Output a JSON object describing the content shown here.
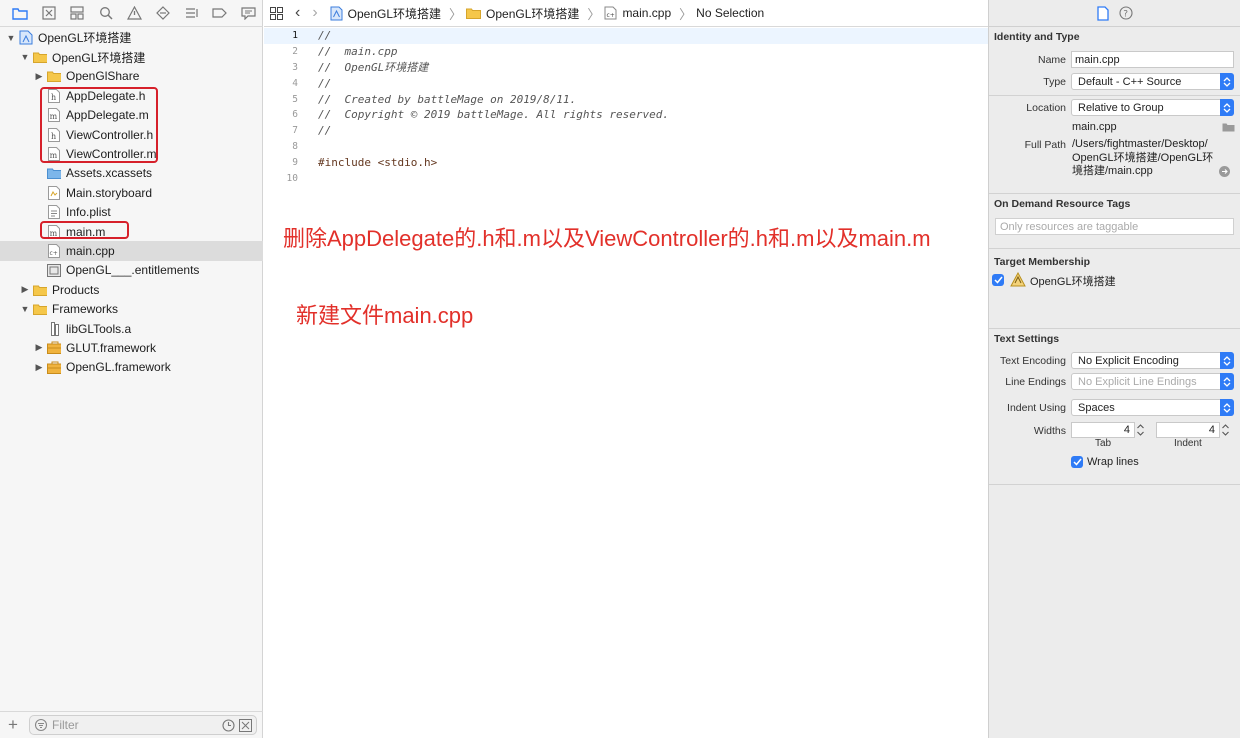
{
  "navigator": {
    "tree": [
      {
        "label": "OpenGL环境搭建",
        "icon": "project-icon",
        "level": 0,
        "disclosure": "open"
      },
      {
        "label": "OpenGL环境搭建",
        "icon": "folder-icon",
        "level": 1,
        "disclosure": "open"
      },
      {
        "label": "OpenGlShare",
        "icon": "folder-icon",
        "level": 2,
        "disclosure": "closed"
      },
      {
        "label": "AppDelegate.h",
        "icon": "header-file-icon",
        "level": 2,
        "disclosure": "none"
      },
      {
        "label": "AppDelegate.m",
        "icon": "objc-file-icon",
        "level": 2,
        "disclosure": "none"
      },
      {
        "label": "ViewController.h",
        "icon": "header-file-icon",
        "level": 2,
        "disclosure": "none"
      },
      {
        "label": "ViewController.m",
        "icon": "objc-file-icon",
        "level": 2,
        "disclosure": "none"
      },
      {
        "label": "Assets.xcassets",
        "icon": "asset-catalog-icon",
        "level": 2,
        "disclosure": "none"
      },
      {
        "label": "Main.storyboard",
        "icon": "storyboard-icon",
        "level": 2,
        "disclosure": "none"
      },
      {
        "label": "Info.plist",
        "icon": "plist-icon",
        "level": 2,
        "disclosure": "none"
      },
      {
        "label": "main.m",
        "icon": "objc-file-icon",
        "level": 2,
        "disclosure": "none"
      },
      {
        "label": "main.cpp",
        "icon": "cpp-file-icon",
        "level": 2,
        "disclosure": "none",
        "selected": true
      },
      {
        "label": "OpenGL___.entitlements",
        "icon": "entitlements-icon",
        "level": 2,
        "disclosure": "none"
      },
      {
        "label": "Products",
        "icon": "folder-icon",
        "level": 1,
        "disclosure": "closed"
      },
      {
        "label": "Frameworks",
        "icon": "folder-icon",
        "level": 1,
        "disclosure": "open"
      },
      {
        "label": "libGLTools.a",
        "icon": "library-icon",
        "level": 2,
        "disclosure": "none"
      },
      {
        "label": "GLUT.framework",
        "icon": "framework-icon",
        "level": 2,
        "disclosure": "closed"
      },
      {
        "label": "OpenGL.framework",
        "icon": "framework-icon",
        "level": 2,
        "disclosure": "closed"
      }
    ],
    "filter_placeholder": "Filter"
  },
  "jumpbar": {
    "crumbs": [
      "OpenGL环境搭建",
      "OpenGL环境搭建",
      "main.cpp",
      "No Selection"
    ]
  },
  "editor": {
    "lines": [
      {
        "n": "1",
        "text": "//",
        "kind": "comment"
      },
      {
        "n": "2",
        "text": "//  main.cpp",
        "kind": "comment"
      },
      {
        "n": "3",
        "text": "//  OpenGL环境搭建",
        "kind": "comment"
      },
      {
        "n": "4",
        "text": "//",
        "kind": "comment"
      },
      {
        "n": "5",
        "text": "//  Created by battleMage on 2019/8/11.",
        "kind": "comment"
      },
      {
        "n": "6",
        "text": "//  Copyright © 2019 battleMage. All rights reserved.",
        "kind": "comment"
      },
      {
        "n": "7",
        "text": "//",
        "kind": "comment"
      },
      {
        "n": "8",
        "text": "",
        "kind": "blank"
      },
      {
        "n": "9",
        "text": "#include <stdio.h>",
        "kind": "directive"
      },
      {
        "n": "10",
        "text": "",
        "kind": "blank"
      }
    ],
    "annotation_delete": "删除AppDelegate的.h和.m以及ViewController的.h和.m以及main.m",
    "annotation_new": "新建文件main.cpp"
  },
  "inspector": {
    "identity_title": "Identity and Type",
    "name_label": "Name",
    "name_value": "main.cpp",
    "type_label": "Type",
    "type_value": "Default - C++ Source",
    "location_label": "Location",
    "location_value": "Relative to Group",
    "location_file": "main.cpp",
    "fullpath_label": "Full Path",
    "fullpath_line1": "/Users/fightmaster/Desktop/",
    "fullpath_line2": "OpenGL环境搭建/OpenGL环",
    "fullpath_line3": "境搭建/main.cpp",
    "ondemand_title": "On Demand Resource Tags",
    "ondemand_placeholder": "Only resources are taggable",
    "membership_title": "Target Membership",
    "membership_target": "OpenGL环境搭建",
    "text_settings_title": "Text Settings",
    "encoding_label": "Text Encoding",
    "encoding_value": "No Explicit Encoding",
    "line_endings_label": "Line Endings",
    "line_endings_value": "No Explicit Line Endings",
    "indent_using_label": "Indent Using",
    "indent_using_value": "Spaces",
    "widths_label": "Widths",
    "tab_value": "4",
    "indent_value": "4",
    "tab_caption": "Tab",
    "indent_caption": "Indent",
    "wrap_label": "Wrap lines"
  },
  "colors": {
    "annotation": "#e2302a",
    "accent": "#2f7bf6",
    "highlight_box": "#d6202a"
  }
}
